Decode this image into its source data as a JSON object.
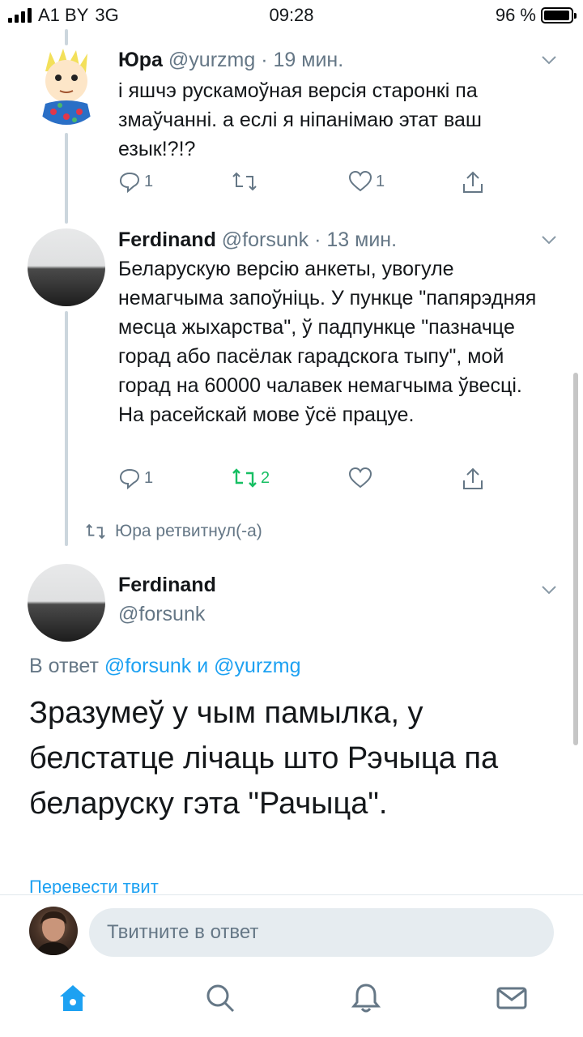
{
  "status_bar": {
    "carrier": "A1 BY",
    "network": "3G",
    "time": "09:28",
    "battery_label": "96 %",
    "battery_level": 0.96
  },
  "tweets": [
    {
      "name": "Юра",
      "handle": "@yurzmg",
      "separator": "·",
      "time": "19 мин.",
      "text": "і яшчэ рускамоўная версія старонкі па змаўчанні. а еслі я ніпанімаю этат ваш езык!?!?",
      "replies": "1",
      "retweets": "",
      "likes": "1"
    },
    {
      "name": "Ferdinand",
      "handle": "@forsunk",
      "separator": "·",
      "time": "13 мин.",
      "text": "Беларускую версію анкеты, увогуле немагчыма запоўніць. У пункце \"папярэдняя месца жыхарства\", ў падпункце \"пазначце горад або пасёлак гарадскога тыпу\", мой горад на 60000 чалавек немагчыма ўвесці. На расейскай мове ўсё працуе.",
      "replies": "1",
      "retweets": "2",
      "likes": ""
    }
  ],
  "retweet_note": "Юра ретвитнул(-а)",
  "main_tweet": {
    "name": "Ferdinand",
    "handle": "@forsunk",
    "reply_prefix": "В ответ",
    "reply_user1": "@forsunk",
    "reply_and": "и",
    "reply_user2": "@yurzmg",
    "text": "Зразумеў у чым памылка, у белстатце лічаць што Рэчыца па беларуску гэта \"Рачыца\".",
    "translate_label": "Перевести твит"
  },
  "reply_bar": {
    "placeholder": "Твитните в ответ"
  },
  "tabs": [
    "home-icon",
    "search-icon",
    "notifications-icon",
    "messages-icon"
  ],
  "colors": {
    "accent": "#1da1f2",
    "retweet_active": "#17bf63",
    "muted": "#657786",
    "text": "#14171a"
  }
}
